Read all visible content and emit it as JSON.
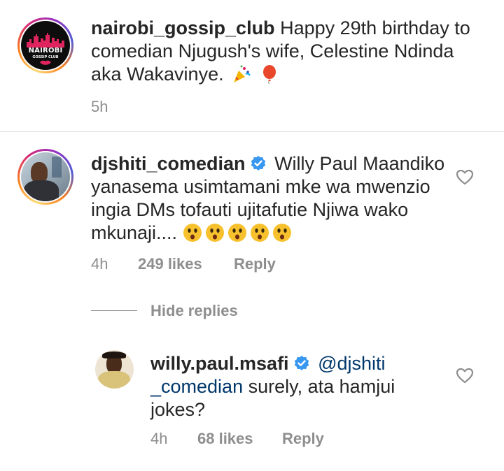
{
  "caption": {
    "username": "nairobi_gossip_club",
    "text": "Happy 29th birthday to comedian Njugush's wife, Celestine Ndinda aka Wakavinye.",
    "emojis": [
      "party-popper-icon",
      "balloon-icon"
    ],
    "time": "5h",
    "avatar": {
      "logo_title": "NAIROBI",
      "logo_subtitle": "GOSSIP CLUB"
    }
  },
  "comments": [
    {
      "username": "djshiti_comedian",
      "verified": true,
      "text": "Willy Paul Maandiko yanasema usimtamani mke wa mwenzio ingia DMs tofauti ujitafutie Njiwa wako mkunaji....",
      "emoji_count": 5,
      "time": "4h",
      "likes": "249 likes",
      "reply_label": "Reply"
    }
  ],
  "hide_replies_label": "Hide replies",
  "reply": {
    "username": "willy.paul.msafi",
    "verified": true,
    "mention": "@djshiti_comedian",
    "text": "surely,  ata hamjui jokes?",
    "time": "4h",
    "likes": "68 likes",
    "reply_label": "Reply"
  },
  "colors": {
    "text": "#262626",
    "muted": "#8e8e8e",
    "mention": "#00376b",
    "verified": "#3897f0"
  }
}
